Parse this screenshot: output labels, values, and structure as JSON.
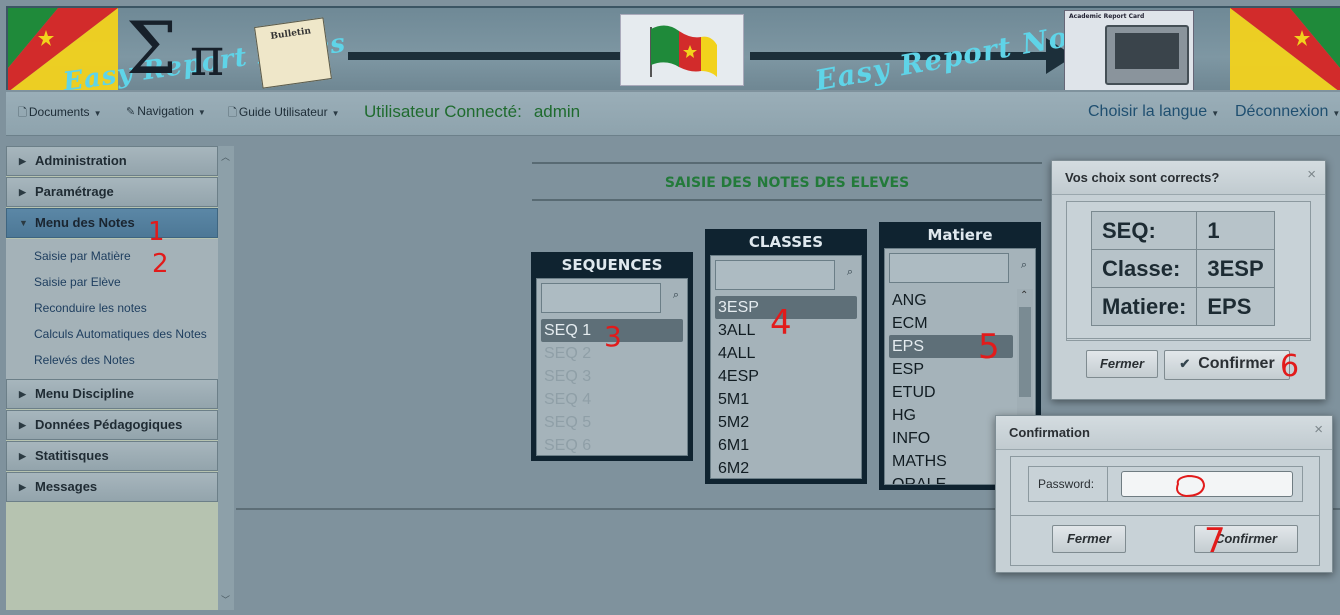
{
  "banner": {
    "brand_left": "Easy Report Notes",
    "brand_right": "Easy Report Notes",
    "bulletin_label": "Bulletin",
    "report_card_label": "Academic Report Card"
  },
  "menubar": {
    "documents": "Documents",
    "navigation": "Navigation",
    "guide": "Guide Utilisateur",
    "user_label": "Utilisateur Connecté:",
    "user_name": "admin",
    "language": "Choisir la langue",
    "logout": "Déconnexion"
  },
  "sidebar": {
    "sections": [
      {
        "label": "Administration"
      },
      {
        "label": "Paramétrage"
      },
      {
        "label": "Menu des Notes"
      },
      {
        "label": "Menu Discipline"
      },
      {
        "label": "Données Pédagogiques"
      },
      {
        "label": "Statitisques"
      },
      {
        "label": "Messages"
      }
    ],
    "notes_items": [
      {
        "label": "Saisie par Matière"
      },
      {
        "label": "Saisie par Elève"
      },
      {
        "label": "Reconduire les notes"
      },
      {
        "label": "Calculs Automatiques des Notes"
      },
      {
        "label": "Relevés des Notes"
      }
    ]
  },
  "main": {
    "title": "SAISIE DES NOTES DES ELEVES",
    "sequences": {
      "header": "SEQUENCES",
      "items": [
        "SEQ 1",
        "SEQ 2",
        "SEQ 3",
        "SEQ 4",
        "SEQ 5",
        "SEQ 6"
      ],
      "selected": "SEQ 1"
    },
    "classes": {
      "header": "CLASSES",
      "items": [
        "3ESP",
        "3ALL",
        "4ALL",
        "4ESP",
        "5M1",
        "5M2",
        "6M1",
        "6M2"
      ],
      "selected": "3ESP"
    },
    "matiere": {
      "header": "Matiere",
      "items": [
        "ANG",
        "ECM",
        "EPS",
        "ESP",
        "ETUD",
        "HG",
        "INFO",
        "MATHS",
        "ORALE"
      ],
      "selected": "EPS"
    }
  },
  "dialog_choices": {
    "title": "Vos choix sont corrects?",
    "close": "×",
    "rows": [
      {
        "label": "SEQ:",
        "value": "1"
      },
      {
        "label": "Classe:",
        "value": "3ESP"
      },
      {
        "label": "Matiere:",
        "value": "EPS"
      }
    ],
    "btn_close": "Fermer",
    "btn_confirm": "Confirmer"
  },
  "dialog_confirm": {
    "title": "Confirmation",
    "close": "×",
    "password_label": "Password:",
    "password_value": "",
    "btn_close": "Fermer",
    "btn_confirm": "Confirmer"
  },
  "annotations": [
    "1",
    "2",
    "3",
    "4",
    "5",
    "6",
    "7"
  ],
  "colors": {
    "accent_green": "#237a3a",
    "link_blue": "#1d3d5e",
    "annotation_red": "#e21b1b",
    "active_section": "#5b87a6"
  }
}
